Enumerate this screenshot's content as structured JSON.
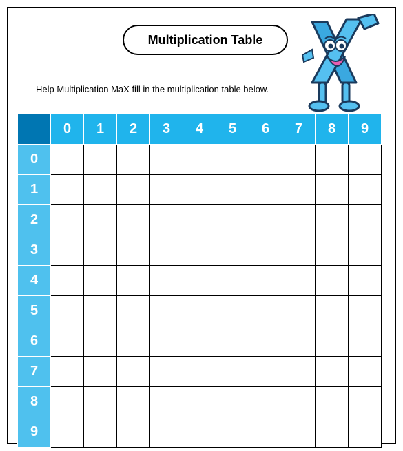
{
  "title": "Multiplication Table",
  "instruction": "Help Multiplication MaX fill in the multiplication table below.",
  "column_headers": [
    "0",
    "1",
    "2",
    "3",
    "4",
    "5",
    "6",
    "7",
    "8",
    "9"
  ],
  "row_headers": [
    "0",
    "1",
    "2",
    "3",
    "4",
    "5",
    "6",
    "7",
    "8",
    "9"
  ],
  "mascot_name": "Multiplication MaX"
}
